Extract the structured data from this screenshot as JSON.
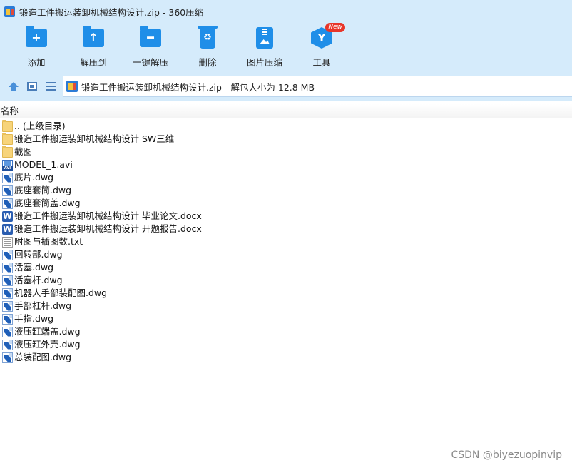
{
  "window": {
    "title": "锻造工件搬运装卸机械结构设计.zip - 360压缩"
  },
  "toolbar": {
    "items": [
      {
        "label": "添加",
        "icon": "add-folder-icon",
        "glyph": "+"
      },
      {
        "label": "解压到",
        "icon": "extract-to-icon",
        "glyph": "↑"
      },
      {
        "label": "一键解压",
        "icon": "one-click-extract-icon",
        "glyph": "━"
      },
      {
        "label": "删除",
        "icon": "recycle-bin-icon",
        "glyph": "♻"
      },
      {
        "label": "图片压缩",
        "icon": "image-compress-icon",
        "glyph": ""
      },
      {
        "label": "工具",
        "icon": "tools-icon",
        "glyph": "Y",
        "badge": "New"
      }
    ]
  },
  "address": {
    "text": "锻造工件搬运装卸机械结构设计.zip - 解包大小为 12.8 MB"
  },
  "columns": {
    "name": "名称"
  },
  "files": [
    {
      "name": ".. (上级目录)",
      "type": "folder"
    },
    {
      "name": "锻造工件搬运装卸机械结构设计 SW三维",
      "type": "folder"
    },
    {
      "name": "截图",
      "type": "folder"
    },
    {
      "name": "MODEL_1.avi",
      "type": "avi"
    },
    {
      "name": "底片.dwg",
      "type": "dwg"
    },
    {
      "name": "底座套筒.dwg",
      "type": "dwg"
    },
    {
      "name": "底座套筒盖.dwg",
      "type": "dwg"
    },
    {
      "name": "锻造工件搬运装卸机械结构设计 毕业论文.docx",
      "type": "doc"
    },
    {
      "name": "锻造工件搬运装卸机械结构设计 开题报告.docx",
      "type": "doc"
    },
    {
      "name": "附图与插图数.txt",
      "type": "txt"
    },
    {
      "name": "回转部.dwg",
      "type": "dwg"
    },
    {
      "name": "活塞.dwg",
      "type": "dwg"
    },
    {
      "name": "活塞杆.dwg",
      "type": "dwg"
    },
    {
      "name": "机器人手部装配图.dwg",
      "type": "dwg"
    },
    {
      "name": "手部杠杆.dwg",
      "type": "dwg"
    },
    {
      "name": "手指.dwg",
      "type": "dwg"
    },
    {
      "name": "液压缸端盖.dwg",
      "type": "dwg"
    },
    {
      "name": "液压缸外壳.dwg",
      "type": "dwg"
    },
    {
      "name": "总装配图.dwg",
      "type": "dwg"
    }
  ],
  "watermark": "CSDN @biyezuopinvip"
}
